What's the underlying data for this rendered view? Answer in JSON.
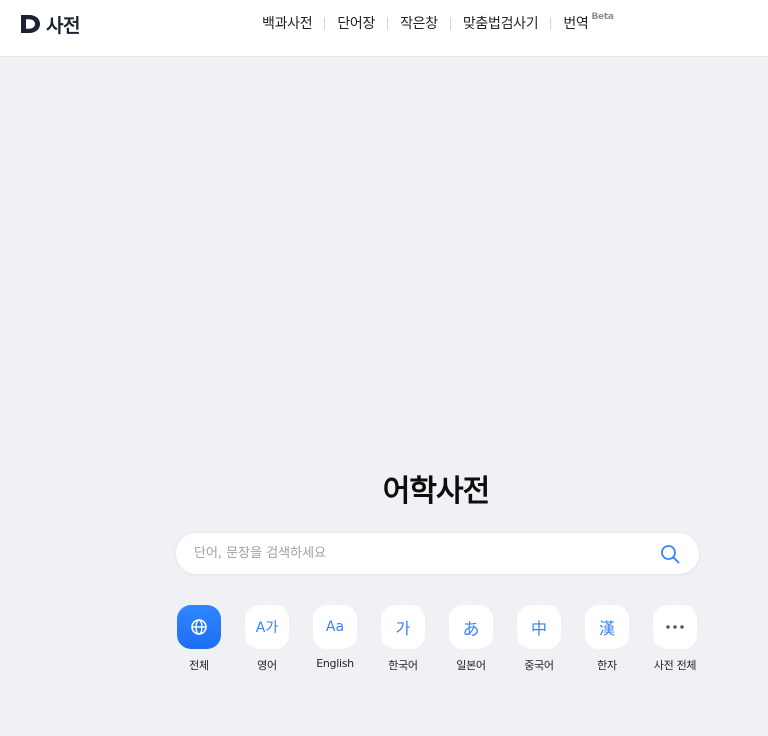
{
  "header": {
    "logo_text": "사전",
    "nav": [
      {
        "label": "백과사전"
      },
      {
        "label": "단어장"
      },
      {
        "label": "작은창"
      },
      {
        "label": "맞춤법검사기"
      },
      {
        "label": "번역",
        "badge": "Beta"
      }
    ]
  },
  "main": {
    "title": "어학사전",
    "search": {
      "placeholder": "단어, 문장을 검색하세요"
    },
    "categories": [
      {
        "label": "전체",
        "icon": "globe-icon",
        "glyph": "",
        "active": true
      },
      {
        "label": "영어",
        "icon": "english-korean-icon",
        "glyph": "A가"
      },
      {
        "label": "English",
        "icon": "english-icon",
        "glyph": "Aa"
      },
      {
        "label": "한국어",
        "icon": "korean-icon",
        "glyph": "가"
      },
      {
        "label": "일본어",
        "icon": "japanese-icon",
        "glyph": "あ"
      },
      {
        "label": "중국어",
        "icon": "chinese-icon",
        "glyph": "中"
      },
      {
        "label": "한자",
        "icon": "hanja-icon",
        "glyph": "漢"
      },
      {
        "label": "사전 전체",
        "icon": "more-icon",
        "glyph": ""
      }
    ]
  },
  "colors": {
    "accent": "#2f86ff",
    "background": "#f0f1f4",
    "logo": "#1c2133"
  }
}
